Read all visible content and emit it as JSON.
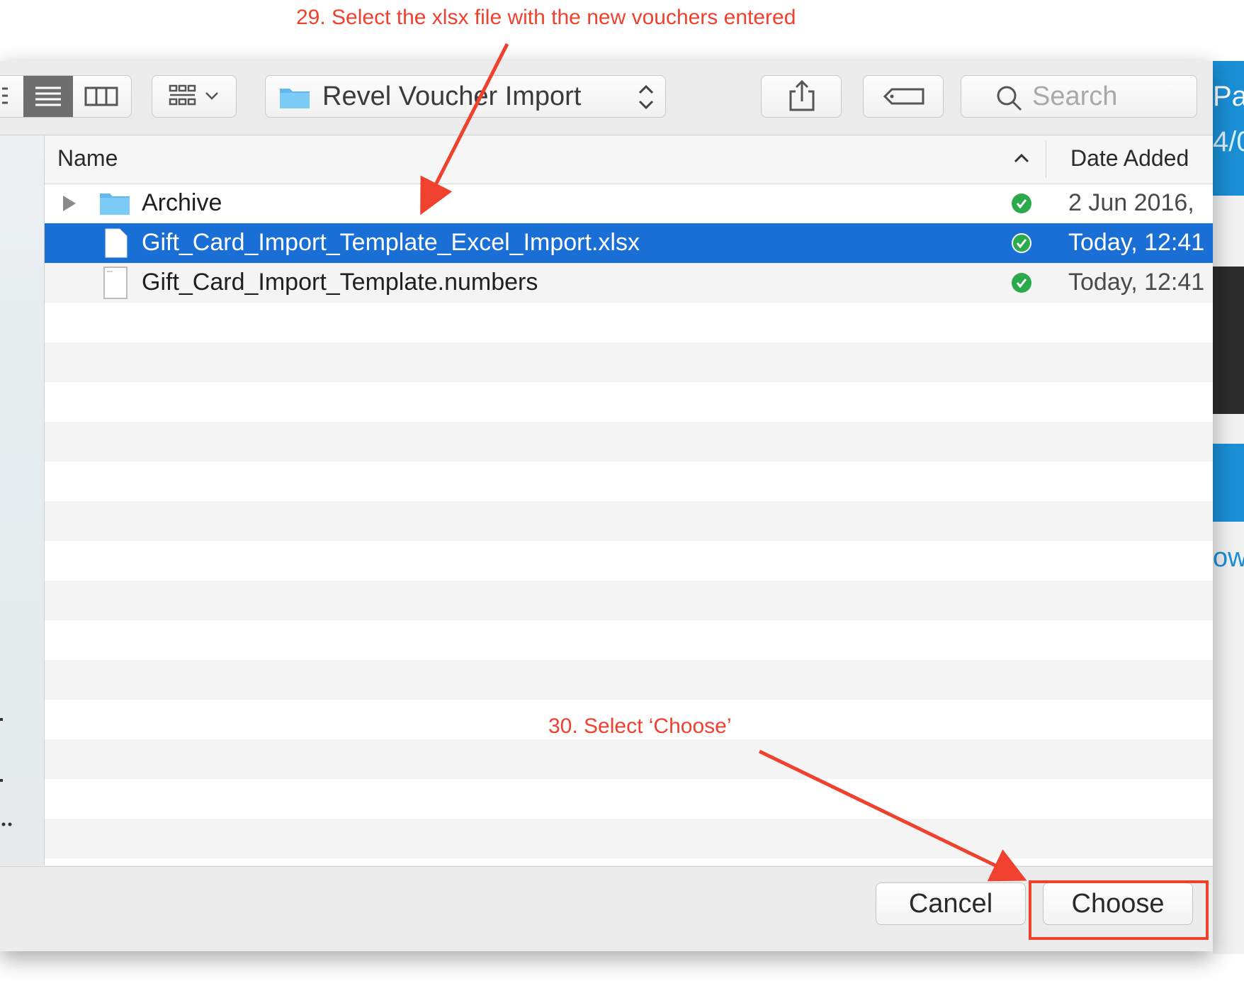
{
  "annotations": {
    "step29": "29. Select the xlsx file with the new vouchers entered",
    "step30": "30. Select ‘Choose’"
  },
  "background_app": {
    "text_top": "Pas",
    "text_mid": "4/0",
    "text_bottom": "ow"
  },
  "toolbar": {
    "view_icons": [
      "column-view-icon",
      "list-view-icon",
      "columns-view-icon",
      "gallery-view-icon"
    ],
    "path_popup": {
      "label": "Revel Voucher Import",
      "icon": "folder-icon"
    },
    "share_icon": "share-icon",
    "tag_icon": "tag-icon",
    "search": {
      "placeholder": "Search",
      "icon": "search-icon"
    }
  },
  "list": {
    "columns": {
      "name": "Name",
      "date_added": "Date Added"
    },
    "rows": [
      {
        "name": "Archive",
        "date": "2 Jun 2016,",
        "kind": "folder",
        "status": "synced",
        "selected": false
      },
      {
        "name": "Gift_Card_Import_Template_Excel_Import.xlsx",
        "date": "Today, 12:41",
        "kind": "file",
        "status": "synced",
        "selected": true
      },
      {
        "name": "Gift_Card_Import_Template.numbers",
        "date": "Today, 12:41",
        "kind": "file",
        "status": "synced",
        "selected": false
      }
    ]
  },
  "footer": {
    "cancel_label": "Cancel",
    "choose_label": "Choose"
  },
  "colors": {
    "accent": "#1a6fd6",
    "annotation": "#f0412e",
    "status_ok": "#2aaa4b"
  }
}
